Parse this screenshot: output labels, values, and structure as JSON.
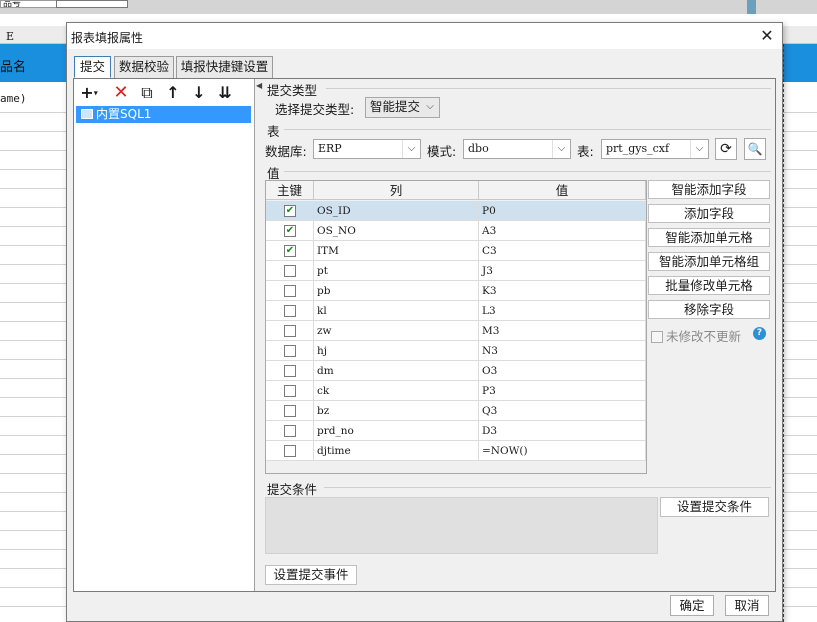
{
  "background": {
    "top_cell_text": "品号",
    "column_label": "E",
    "header_cell": "品名",
    "name_cell": "ame)"
  },
  "dialog": {
    "title": "报表填报属性",
    "close_icon": "close-icon",
    "tabs": [
      "提交",
      "数据校验",
      "填报快捷键设置"
    ],
    "active_tab": "提交",
    "tree": {
      "item": "内置SQL1"
    },
    "submit_type": {
      "section": "提交类型",
      "label": "选择提交类型:",
      "value": "智能提交"
    },
    "table_section": {
      "section": "表",
      "db_label": "数据库:",
      "db_value": "ERP",
      "schema_label": "模式:",
      "schema_value": "dbo",
      "table_label": "表:",
      "table_value": "prt_gys_cxf"
    },
    "value_section": {
      "section": "值",
      "columns": [
        "主键",
        "列",
        "值"
      ],
      "rows": [
        {
          "key": true,
          "col": "OS_ID",
          "val": "P0"
        },
        {
          "key": true,
          "col": "OS_NO",
          "val": "A3"
        },
        {
          "key": true,
          "col": "ITM",
          "val": "C3"
        },
        {
          "key": false,
          "col": "pt",
          "val": "J3"
        },
        {
          "key": false,
          "col": "pb",
          "val": "K3"
        },
        {
          "key": false,
          "col": "kl",
          "val": "L3"
        },
        {
          "key": false,
          "col": "zw",
          "val": "M3"
        },
        {
          "key": false,
          "col": "hj",
          "val": "N3"
        },
        {
          "key": false,
          "col": "dm",
          "val": "O3"
        },
        {
          "key": false,
          "col": "ck",
          "val": "P3"
        },
        {
          "key": false,
          "col": "bz",
          "val": "Q3"
        },
        {
          "key": false,
          "col": "prd_no",
          "val": "D3"
        },
        {
          "key": false,
          "col": "djtime",
          "val": "=NOW()"
        }
      ],
      "selected_row": 0
    },
    "side_buttons": [
      "智能添加字段",
      "添加字段",
      "智能添加单元格",
      "智能添加单元格组",
      "批量修改单元格",
      "移除字段"
    ],
    "unchanged_no_update": "未修改不更新",
    "condition": {
      "section": "提交条件",
      "button": "设置提交条件"
    },
    "event_button": "设置提交事件",
    "ok": "确定",
    "cancel": "取消"
  }
}
